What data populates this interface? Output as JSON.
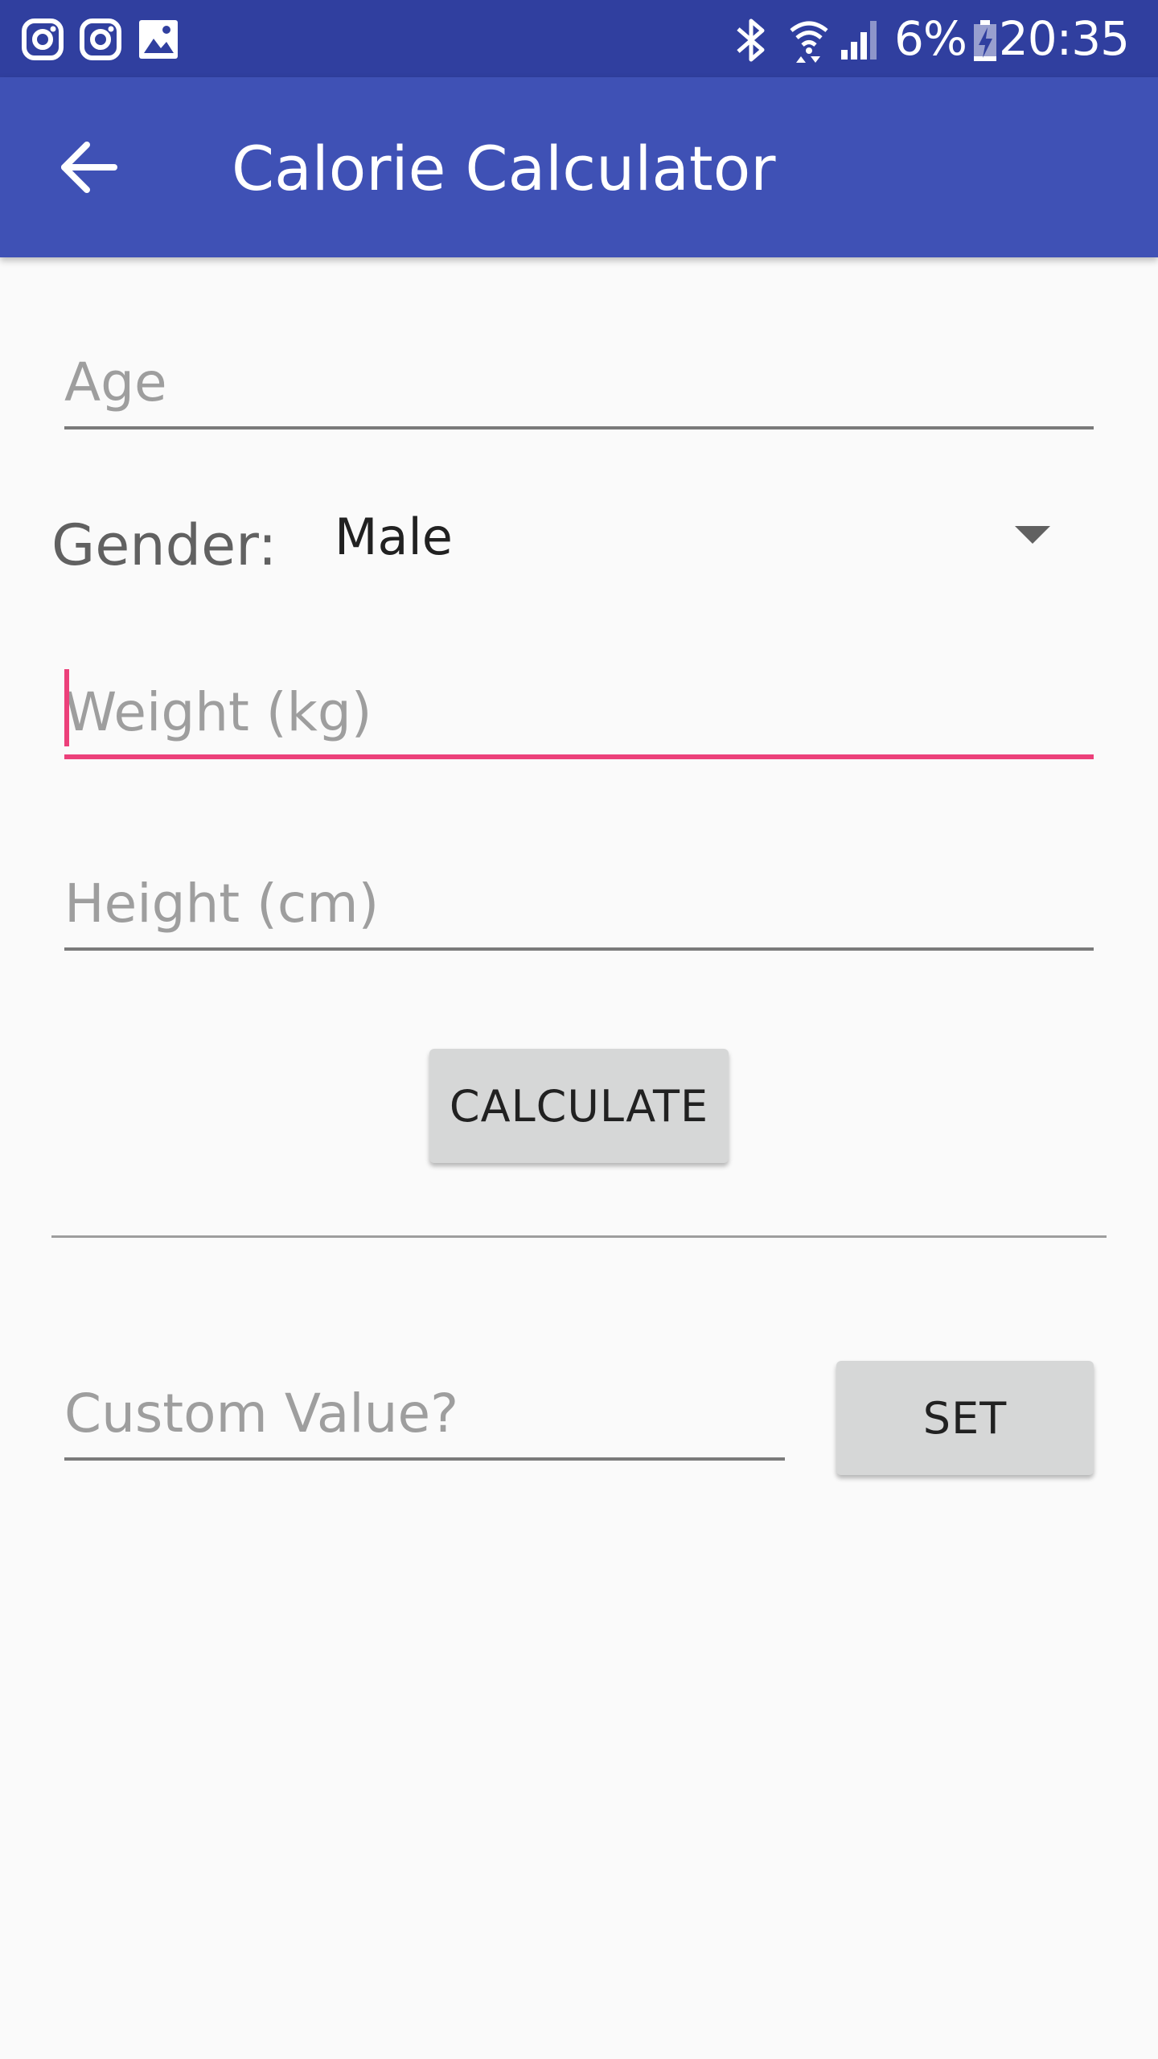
{
  "status_bar": {
    "left_icons": [
      "instagram-icon",
      "instagram-icon",
      "image-icon"
    ],
    "right_icons": [
      "bluetooth-icon",
      "wifi-icon",
      "signal-icon",
      "battery-charging-icon"
    ],
    "battery": "6%",
    "time": "20:35"
  },
  "app_bar": {
    "title": "Calorie Calculator",
    "back_icon": "arrow-back-icon"
  },
  "form": {
    "age": {
      "placeholder": "Age",
      "value": ""
    },
    "gender": {
      "label": "Gender:",
      "selected": "Male"
    },
    "weight": {
      "placeholder": "Weight (kg)",
      "value": "",
      "focused": true
    },
    "height": {
      "placeholder": "Height (cm)",
      "value": ""
    },
    "calculate_label": "CALCULATE"
  },
  "custom": {
    "placeholder": "Custom Value?",
    "value": "",
    "set_label": "SET"
  },
  "colors": {
    "status_bar": "#303f9f",
    "app_bar": "#3f51b5",
    "accent": "#ec407a",
    "background": "#fafafa",
    "button": "#d6d7d7"
  }
}
